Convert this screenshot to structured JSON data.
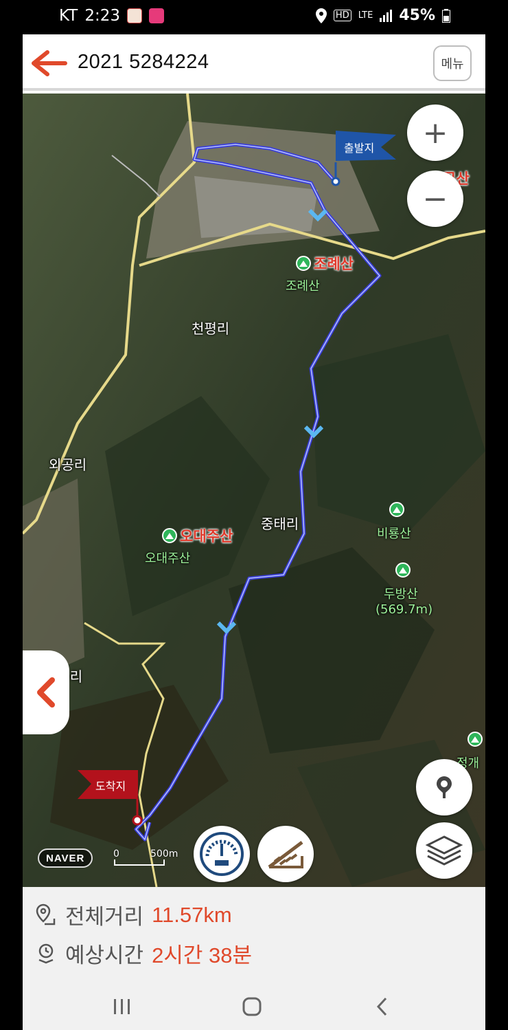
{
  "status_bar": {
    "carrier": "KT",
    "time": "2:23",
    "network": "LTE",
    "hd": "HD",
    "battery": "45%"
  },
  "header": {
    "title": "2021 5284224",
    "menu_label": "메뉴",
    "back_icon": "arrow-left-icon"
  },
  "map": {
    "start_flag": "출발지",
    "end_flag": "도착지",
    "zoom_in": "+",
    "zoom_out": "−",
    "places": {
      "cheonpyeong": "천평리",
      "oegong": "외공리",
      "jungtae": "중태리",
      "naegong": "내공리"
    },
    "mountains": {
      "jore_red": "조례산",
      "jore_green": "조례산",
      "odaeju_red": "오대주산",
      "odaeju_green": "오대주산",
      "biryong": "비룡산",
      "dubang": "두방산",
      "dubang_height": "(569.7m)",
      "jeonggae": "정개",
      "top_right": "무산"
    },
    "attribution": "NAVER",
    "scale_zero": "0",
    "scale_distance": "500m"
  },
  "summary": {
    "distance_label": "전체거리",
    "distance_value": "11.57km",
    "time_label": "예상시간",
    "time_value": "2시간 38분"
  },
  "colors": {
    "accent": "#e0492b",
    "route": "#3b3fd8",
    "start_flag": "#1f55a8",
    "end_flag": "#b3121c"
  }
}
